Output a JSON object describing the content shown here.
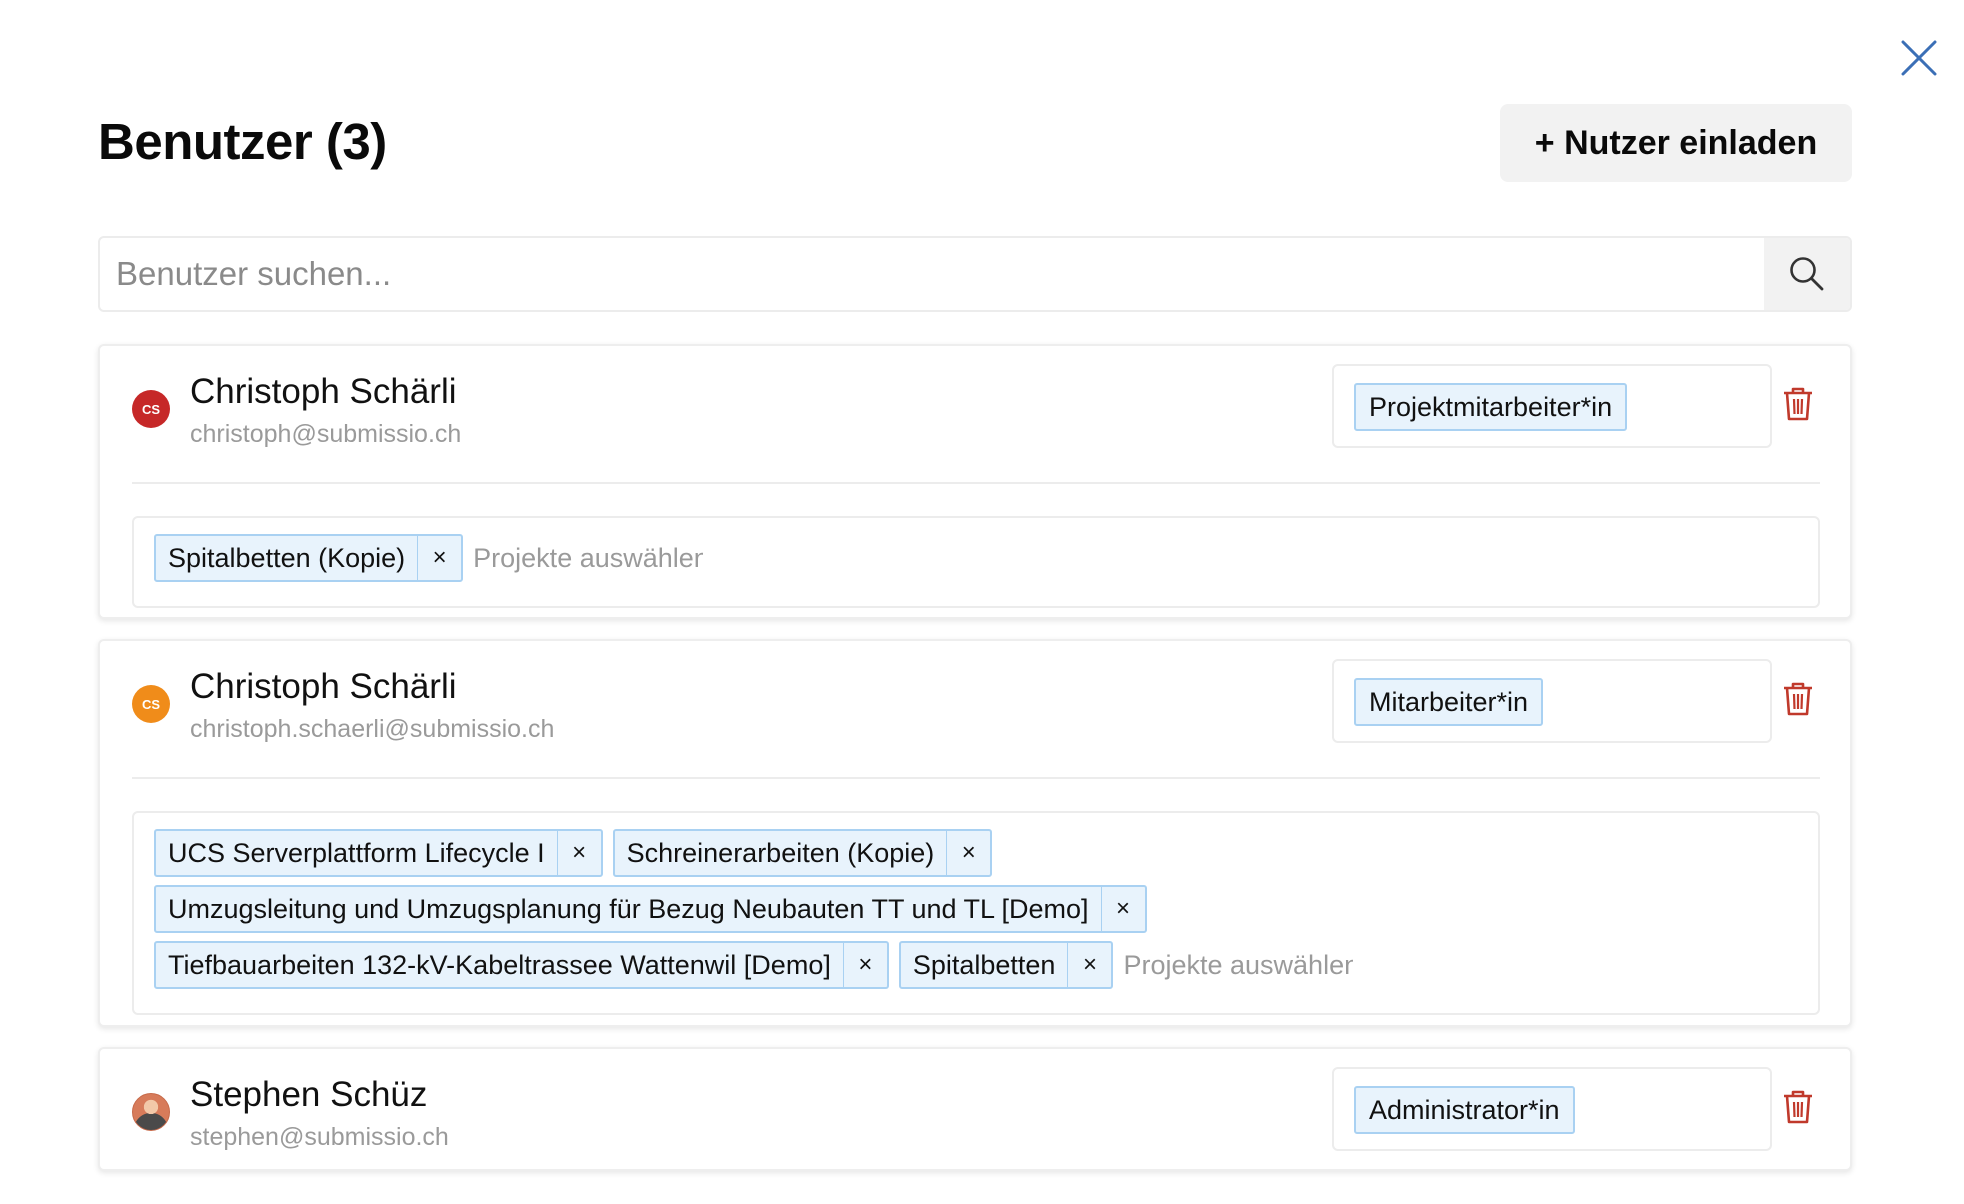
{
  "page": {
    "title": "Benutzer (3)",
    "invite_label": "+ Nutzer einladen"
  },
  "search": {
    "placeholder": "Benutzer suchen..."
  },
  "users": [
    {
      "name": "Christoph Schärli",
      "email": "christoph@submissio.ch",
      "initials": "CS",
      "avatar_color": "#c62828",
      "role": "Projektmitarbeiter*in",
      "projects": [
        "Spitalbetten (Kopie)"
      ],
      "projects_placeholder": "Projekte auswählen"
    },
    {
      "name": "Christoph Schärli",
      "email": "christoph.schaerli@submissio.ch",
      "initials": "CS",
      "avatar_color": "#f08c1a",
      "role": "Mitarbeiter*in",
      "projects": [
        "UCS Serverplattform Lifecycle I",
        "Schreinerarbeiten (Kopie)",
        "Umzugsleitung und Umzugsplanung für Bezug Neubauten TT und TL [Demo]",
        "Tiefbauarbeiten 132-kV-Kabeltrassee Wattenwil [Demo]",
        "Spitalbetten"
      ],
      "projects_placeholder": "Projekte auswählen"
    },
    {
      "name": "Stephen Schüz",
      "email": "stephen@submissio.ch",
      "role": "Administrator*in"
    }
  ],
  "chip_remove_symbol": "×",
  "colors": {
    "close_icon": "#3b6fb6",
    "trash_icon": "#c0392b",
    "tag_bg": "#e8f3fc",
    "tag_border": "#a9d1f2",
    "button_bg": "#f2f2f2"
  }
}
